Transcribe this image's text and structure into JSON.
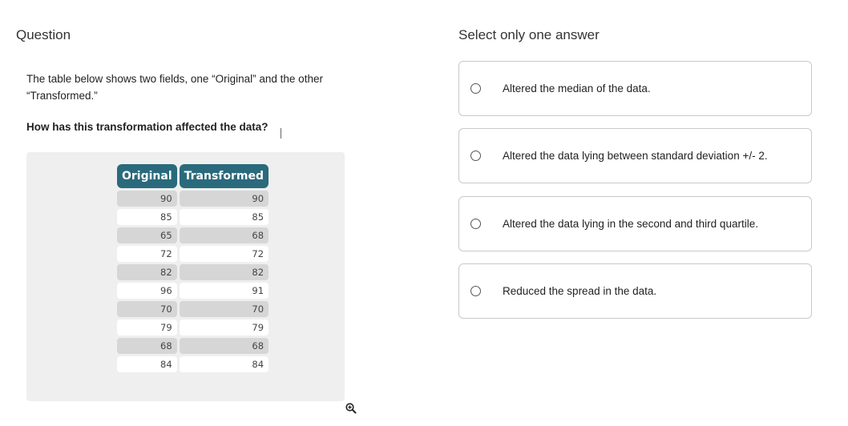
{
  "question": {
    "heading": "Question",
    "text": "The table below shows two fields, one “Original” and the other “Transformed.”",
    "prompt": "How has this transformation affected the data?"
  },
  "table": {
    "headers": [
      "Original",
      "Transformed"
    ],
    "rows": [
      [
        "90",
        "90"
      ],
      [
        "85",
        "85"
      ],
      [
        "65",
        "68"
      ],
      [
        "72",
        "72"
      ],
      [
        "82",
        "82"
      ],
      [
        "96",
        "91"
      ],
      [
        "70",
        "70"
      ],
      [
        "79",
        "79"
      ],
      [
        "68",
        "68"
      ],
      [
        "84",
        "84"
      ]
    ]
  },
  "icons": {
    "zoom": "zoom-in-icon",
    "radio": "radio-button-icon"
  },
  "answers": {
    "heading": "Select only one answer",
    "options": [
      "Altered the median of the data.",
      "Altered the data lying between standard deviation +/- 2.",
      "Altered the data lying in the second and third quartile.",
      "Reduced the spread in the data."
    ]
  },
  "colors": {
    "header_bg": "#2a6a7c",
    "row_shaded": "#d6d6d6",
    "panel_bg": "#efefef"
  }
}
